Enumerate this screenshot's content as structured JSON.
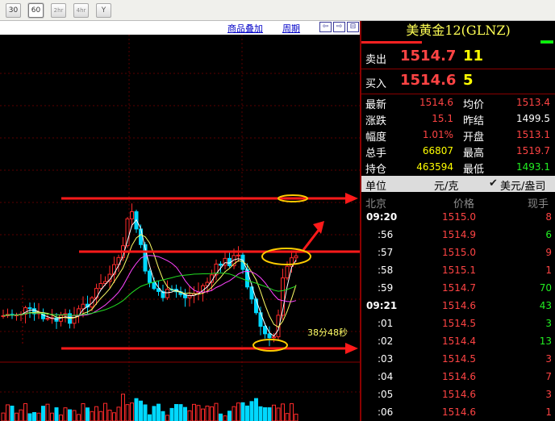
{
  "toolbar": {
    "periods": [
      "30",
      "60",
      "2hr",
      "4hr",
      "Y"
    ],
    "active": "60"
  },
  "chart_header": {
    "overlay_link": "商品叠加",
    "period_link": "周期",
    "nav_buttons": [
      "⇦",
      "⇨",
      "⊟"
    ]
  },
  "chart": {
    "countdown": "38分48秒",
    "colors": {
      "up": "#ff2a2a",
      "down": "#00d8ff",
      "ma5": "#ffffff",
      "ma10": "#ffff66",
      "ma20": "#ff44ff",
      "ma60": "#22dd22",
      "annotation": "#ff1a1a",
      "highlight": "#ffcc00"
    }
  },
  "panel": {
    "title": "美黄金12(GLNZ)",
    "sell": {
      "label": "卖出",
      "price": "1514.7",
      "volume": "11"
    },
    "buy": {
      "label": "买入",
      "price": "1514.6",
      "volume": "5"
    },
    "stats": [
      {
        "label": "最新",
        "value": "1514.6",
        "label2": "均价",
        "value2": "1513.4"
      },
      {
        "label": "涨跌",
        "value": "15.1",
        "label2": "昨结",
        "value2": "1499.5"
      },
      {
        "label": "幅度",
        "value": "1.01%",
        "label2": "开盘",
        "value2": "1513.1"
      },
      {
        "label": "总手",
        "value": "66807",
        "label2": "最高",
        "value2": "1519.7"
      },
      {
        "label": "持仓",
        "value": "463594",
        "label2": "最低",
        "value2": "1493.1"
      }
    ],
    "unit": {
      "label": "单位",
      "weight": "元/克",
      "currency": "美元/盎司"
    },
    "ticks_header": {
      "city": "北京",
      "price": "价格",
      "volume": "现手"
    },
    "ticks": [
      {
        "time": "09:20",
        "price": "1515.0",
        "volume": "8",
        "dir": "up"
      },
      {
        "time": ":56",
        "price": "1514.9",
        "volume": "6",
        "dir": "down"
      },
      {
        "time": ":57",
        "price": "1515.0",
        "volume": "9",
        "dir": "up"
      },
      {
        "time": ":58",
        "price": "1515.1",
        "volume": "1",
        "dir": "up"
      },
      {
        "time": ":59",
        "price": "1514.7",
        "volume": "70",
        "dir": "down"
      },
      {
        "time": "09:21",
        "price": "1514.6",
        "volume": "43",
        "dir": "down"
      },
      {
        "time": ":01",
        "price": "1514.5",
        "volume": "3",
        "dir": "down"
      },
      {
        "time": ":02",
        "price": "1514.4",
        "volume": "13",
        "dir": "down"
      },
      {
        "time": ":03",
        "price": "1514.5",
        "volume": "3",
        "dir": "up"
      },
      {
        "time": ":04",
        "price": "1514.6",
        "volume": "7",
        "dir": "up"
      },
      {
        "time": ":05",
        "price": "1514.6",
        "volume": "3",
        "dir": "up"
      },
      {
        "time": ":06",
        "price": "1514.6",
        "volume": "1",
        "dir": "up"
      }
    ]
  }
}
